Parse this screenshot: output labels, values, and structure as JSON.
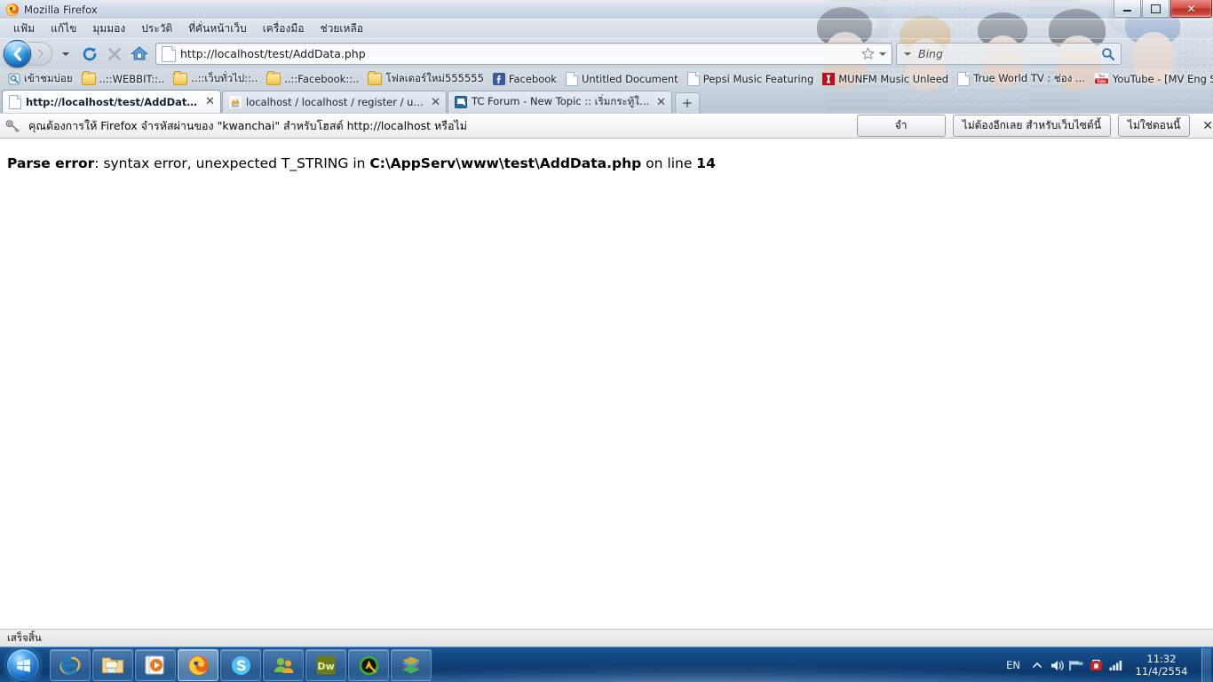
{
  "window": {
    "title": "Mozilla Firefox",
    "app_icon": "firefox-icon",
    "controls": {
      "minimize": "minimize-button",
      "maximize": "restore-button",
      "close": "✕"
    }
  },
  "menubar": {
    "items": [
      {
        "label": "แฟ้ม",
        "name": "menu-file"
      },
      {
        "label": "แก้ไข",
        "name": "menu-edit"
      },
      {
        "label": "มุมมอง",
        "name": "menu-view"
      },
      {
        "label": "ประวัติ",
        "name": "menu-history"
      },
      {
        "label": "ที่คั่นหน้าเว็บ",
        "name": "menu-bookmarks"
      },
      {
        "label": "เครื่องมือ",
        "name": "menu-tools"
      },
      {
        "label": "ช่วยเหลือ",
        "name": "menu-help"
      }
    ]
  },
  "navbar": {
    "back_tooltip": "Back",
    "forward_tooltip": "Forward",
    "reload_tooltip": "Reload",
    "stop_tooltip": "Stop",
    "home_tooltip": "Home",
    "url": "http://localhost/test/AddData.php",
    "url_placeholder": "",
    "search_value": "",
    "search_placeholder": "Bing",
    "search_engine": "Bing"
  },
  "bookmarks": [
    {
      "label": "เข้าชมบ่อย",
      "icon": "smart-bookmark-icon"
    },
    {
      "label": "..::WEBBIT::..",
      "icon": "folder-icon"
    },
    {
      "label": "..::เว็บทั่วไป::..",
      "icon": "folder-icon"
    },
    {
      "label": "..::Facebook::..",
      "icon": "folder-icon"
    },
    {
      "label": "โฟลเดอร์ใหม่555555",
      "icon": "folder-icon"
    },
    {
      "label": "Facebook",
      "icon": "facebook-icon"
    },
    {
      "label": "Untitled Document",
      "icon": "page-icon"
    },
    {
      "label": "Pepsi Music Featuring",
      "icon": "page-icon"
    },
    {
      "label": "MUNFM Music Unleed",
      "icon": "munfm-icon"
    },
    {
      "label": "True World TV : ช่อง ...",
      "icon": "page-icon"
    },
    {
      "label": "YouTube - [MV Eng Su...",
      "icon": "youtube-icon"
    }
  ],
  "tabs": [
    {
      "label": "http://localhost/test/AddData.php",
      "icon": "page-icon",
      "active": true,
      "close": "✕"
    },
    {
      "label": "localhost / localhost / register / use...",
      "icon": "phpmyadmin-icon",
      "active": false,
      "close": "✕"
    },
    {
      "label": "TC Forum - New Topic :: เริ่มกระทู้ใหม่",
      "icon": "forum-icon",
      "active": false,
      "close": "✕"
    }
  ],
  "newtab_label": "+",
  "notification": {
    "icon": "key-icon",
    "message": "คุณต้องการให้ Firefox จำรหัสผ่านของ \"kwanchai\" สำหรับโฮสต์ http://localhost หรือไม่",
    "buttons": [
      {
        "label": "จำ",
        "name": "remember-password-button"
      },
      {
        "label": "ไม่ต้องอีกเลย สำหรับเว็บไซต์นี้",
        "name": "never-for-this-site-button"
      },
      {
        "label": "ไม่ใช่ตอนนี้",
        "name": "not-now-button"
      }
    ],
    "close": "✕"
  },
  "content": {
    "error_label": "Parse error",
    "error_sep": ": ",
    "error_message": "syntax error, unexpected T_STRING in ",
    "error_file": "C:\\AppServ\\www\\test\\AddData.php",
    "error_online": " on line ",
    "error_line": "14"
  },
  "statusbar": {
    "text": "เสร็จสิ้น"
  },
  "taskbar": {
    "start": "start-orb",
    "items": [
      {
        "name": "taskbar-internet-explorer",
        "icon": "internet-explorer-icon"
      },
      {
        "name": "taskbar-explorer",
        "icon": "windows-explorer-icon"
      },
      {
        "name": "taskbar-media-player",
        "icon": "windows-media-player-icon"
      },
      {
        "name": "taskbar-firefox",
        "icon": "firefox-icon",
        "active": true
      },
      {
        "name": "taskbar-skype",
        "icon": "skype-icon"
      },
      {
        "name": "taskbar-msn",
        "icon": "msn-messenger-icon"
      },
      {
        "name": "taskbar-dreamweaver",
        "icon": "dreamweaver-icon"
      },
      {
        "name": "taskbar-appserv",
        "icon": "appserv-icon"
      },
      {
        "name": "taskbar-winrar",
        "icon": "winrar-icon"
      }
    ],
    "tray": {
      "language": "EN",
      "show_hidden": "show-hidden-icons-icon",
      "volume": "volume-icon",
      "network_flag": "network-icon",
      "antivirus": "antivirus-icon",
      "signal": "signal-icon",
      "time": "11:32",
      "date": "11/4/2554"
    }
  },
  "colors": {
    "accent": "#1566b8",
    "taskbar": "#11437c",
    "close_button": "#bb2f26",
    "error_text": "#000000"
  }
}
